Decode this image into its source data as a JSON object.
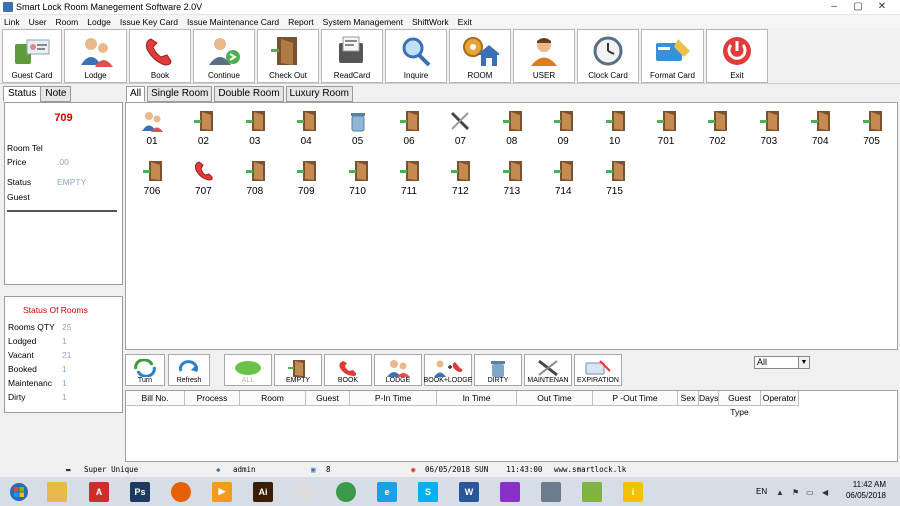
{
  "window": {
    "title": "Smart Lock Room Manegement Software 2.0V",
    "controls": [
      "–",
      "▢",
      "✕"
    ]
  },
  "menu": [
    "Link",
    "User",
    "Room",
    "Lodge",
    "Issue Key Card",
    "Issue Maintenance Card",
    "Report",
    "System Management",
    "ShiftWork",
    "Exit"
  ],
  "toolbar": [
    {
      "label": "Guest Card",
      "icon": "guest-card-icon"
    },
    {
      "label": "Lodge",
      "icon": "lodge-people-icon"
    },
    {
      "label": "Book",
      "icon": "phone-icon"
    },
    {
      "label": "Continue",
      "icon": "continue-user-icon"
    },
    {
      "label": "Check Out",
      "icon": "door-exit-icon"
    },
    {
      "label": "ReadCard",
      "icon": "card-reader-icon"
    },
    {
      "label": "Inquire",
      "icon": "magnifier-icon"
    },
    {
      "label": "ROOM",
      "icon": "room-gear-house-icon"
    },
    {
      "label": "USER",
      "icon": "user-icon"
    },
    {
      "label": "Clock Card",
      "icon": "clock-icon"
    },
    {
      "label": "Format Card",
      "icon": "format-card-icon"
    },
    {
      "label": "Exit",
      "icon": "power-icon"
    }
  ],
  "left_tabs": [
    "Status",
    "Note"
  ],
  "status": {
    "room": "709",
    "room_tel_label": "Room Tel",
    "price_label": "Price",
    "price": ".00",
    "status_label": "Status",
    "status_value": "EMPTY",
    "guest_label": "Guest"
  },
  "status_of_rooms": {
    "title": "Status Of Rooms",
    "rows": [
      {
        "label": "Rooms QTY",
        "value": "25"
      },
      {
        "label": "Lodged",
        "value": "1"
      },
      {
        "label": "Vacant",
        "value": "21"
      },
      {
        "label": "Booked",
        "value": "1"
      },
      {
        "label": "Maintenanc",
        "value": "1"
      },
      {
        "label": "Dirty",
        "value": "1"
      }
    ]
  },
  "room_tabs": [
    "All",
    "Single Room",
    "Double Room",
    "Luxury Room"
  ],
  "rooms": [
    {
      "num": "01",
      "state": "lodged"
    },
    {
      "num": "02",
      "state": "empty"
    },
    {
      "num": "03",
      "state": "empty"
    },
    {
      "num": "04",
      "state": "empty"
    },
    {
      "num": "05",
      "state": "dirty"
    },
    {
      "num": "06",
      "state": "empty"
    },
    {
      "num": "07",
      "state": "maintenance"
    },
    {
      "num": "08",
      "state": "empty"
    },
    {
      "num": "09",
      "state": "empty"
    },
    {
      "num": "10",
      "state": "empty"
    },
    {
      "num": "701",
      "state": "empty"
    },
    {
      "num": "702",
      "state": "empty"
    },
    {
      "num": "703",
      "state": "empty"
    },
    {
      "num": "704",
      "state": "empty"
    },
    {
      "num": "705",
      "state": "empty"
    },
    {
      "num": "706",
      "state": "empty"
    },
    {
      "num": "707",
      "state": "booked"
    },
    {
      "num": "708",
      "state": "empty"
    },
    {
      "num": "709",
      "state": "empty"
    },
    {
      "num": "710",
      "state": "empty"
    },
    {
      "num": "711",
      "state": "empty"
    },
    {
      "num": "712",
      "state": "empty"
    },
    {
      "num": "713",
      "state": "empty"
    },
    {
      "num": "714",
      "state": "empty"
    },
    {
      "num": "715",
      "state": "empty"
    }
  ],
  "actions": [
    {
      "label": "Turn",
      "icon": "turn-arrows-icon"
    },
    {
      "label": "Refresh",
      "icon": "refresh-icon"
    },
    {
      "label": "ALL",
      "icon": "all-ellipse-icon",
      "disabled": true
    },
    {
      "label": "EMPTY",
      "icon": "empty-door-icon"
    },
    {
      "label": "BOOK",
      "icon": "book-phone-icon"
    },
    {
      "label": "LODGE",
      "icon": "lodge-people-icon"
    },
    {
      "label": "BOOK+LODGE",
      "icon": "book-lodge-icon"
    },
    {
      "label": "DIRTY",
      "icon": "dirty-bin-icon"
    },
    {
      "label": "MAINTENAN",
      "icon": "maintenance-tools-icon"
    },
    {
      "label": "EXPIRATION",
      "icon": "expiration-icon"
    }
  ],
  "filter": {
    "value": "All"
  },
  "grid_columns": [
    "Bill No.",
    "Process",
    "Room",
    "Guest",
    "P-In Time",
    "In Time",
    "Out Time",
    "P -Out Time",
    "Sex",
    "Days",
    "Guest Type",
    "Operator"
  ],
  "statusbar": {
    "company": "Super Unique",
    "user": "admin",
    "count": "8",
    "datetime": "06/05/2018 SUN    11:43:00",
    "website": "www.smartlock.lk"
  },
  "taskbar": {
    "apps": [
      {
        "name": "file-explorer",
        "color": "#e8b84a",
        "text": ""
      },
      {
        "name": "pdf-reader",
        "color": "#c9302c",
        "text": "A"
      },
      {
        "name": "photoshop",
        "color": "#1e3a5f",
        "text": "Ps"
      },
      {
        "name": "firefox",
        "color": "#e66000",
        "text": ""
      },
      {
        "name": "media-player",
        "color": "#f29b1d",
        "text": "▶"
      },
      {
        "name": "illustrator",
        "color": "#3a1d05",
        "text": "Ai"
      },
      {
        "name": "paint",
        "color": "#dcdcdc",
        "text": ""
      },
      {
        "name": "chrome",
        "color": "#3b9a4a",
        "text": ""
      },
      {
        "name": "internet-explorer",
        "color": "#1ba1e2",
        "text": "e"
      },
      {
        "name": "skype",
        "color": "#00aff0",
        "text": "S"
      },
      {
        "name": "word",
        "color": "#2b579a",
        "text": "W"
      },
      {
        "name": "smartlock-app",
        "color": "#8b2fc9",
        "text": ""
      },
      {
        "name": "calculator",
        "color": "#6b7b8c",
        "text": ""
      },
      {
        "name": "music-app",
        "color": "#7fb241",
        "text": ""
      },
      {
        "name": "info-app",
        "color": "#f2c200",
        "text": "i"
      }
    ],
    "lang": "EN",
    "time": "11:42 AM",
    "date": "06/05/2018"
  }
}
